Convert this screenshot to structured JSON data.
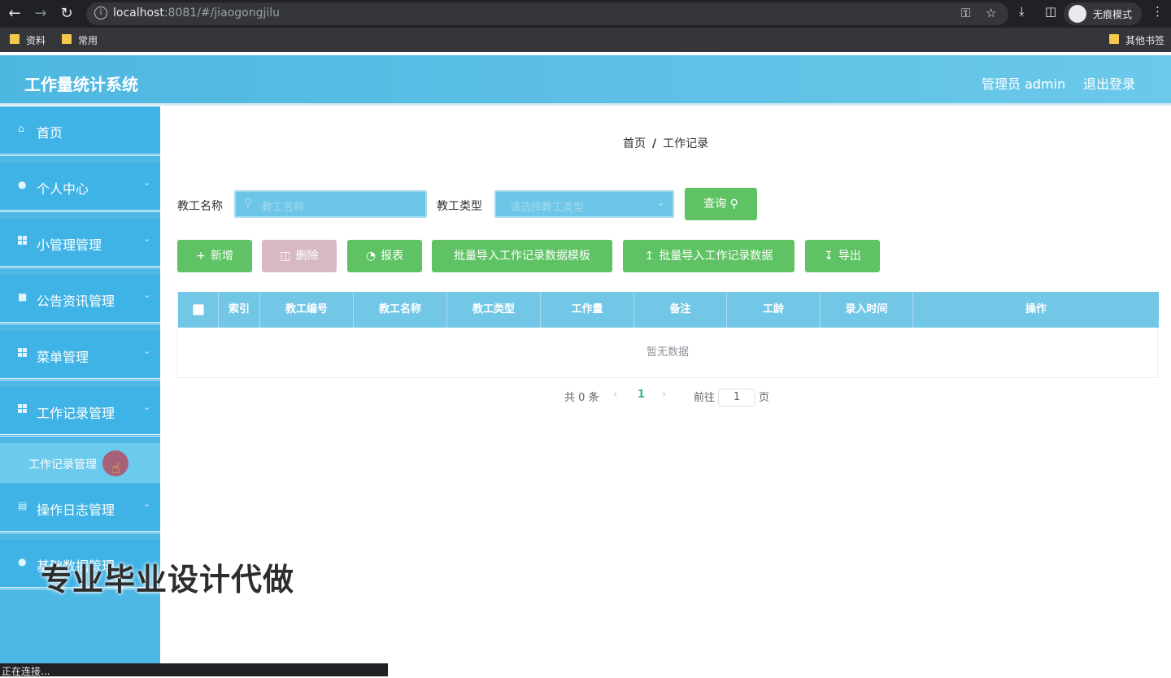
{
  "browser": {
    "url_host": "localhost",
    "url_rest": ":8081/#/jiaogongjilu",
    "incognito_label": "无痕模式",
    "bookmarks": [
      "资料",
      "常用"
    ],
    "other_bookmarks": "其他书签",
    "status_text": "正在连接..."
  },
  "header": {
    "title": "工作量统计系统",
    "admin_label": "管理员 admin",
    "logout_label": "退出登录"
  },
  "sidebar": {
    "items": [
      {
        "label": "首页",
        "icon": "home-icon"
      },
      {
        "label": "个人中心",
        "icon": "user-icon"
      },
      {
        "label": "小管理管理",
        "icon": "grid-icon"
      },
      {
        "label": "公告资讯管理",
        "icon": "message-icon"
      },
      {
        "label": "菜单管理",
        "icon": "grid-icon"
      },
      {
        "label": "工作记录管理",
        "icon": "grid-icon"
      },
      {
        "label": "操作日志管理",
        "icon": "briefcase-icon"
      },
      {
        "label": "基础数据管理",
        "icon": "user-icon"
      }
    ],
    "sub_item": "工作记录管理"
  },
  "watermark": "专业毕业设计代做",
  "breadcrumb": {
    "home": "首页",
    "sep": "/",
    "current": "工作记录"
  },
  "filters": {
    "name_label": "教工名称",
    "name_placeholder": "教工名称",
    "type_label": "教工类型",
    "type_placeholder": "请选择教工类型",
    "query_button": "查询"
  },
  "actions": {
    "add": "新增",
    "delete": "删除",
    "report": "报表",
    "import_template": "批量导入工作记录数据模板",
    "import_data": "批量导入工作记录数据",
    "export": "导出"
  },
  "table": {
    "headers": [
      "索引",
      "教工编号",
      "教工名称",
      "教工类型",
      "工作量",
      "备注",
      "工龄",
      "录入时间",
      "操作"
    ],
    "empty_text": "暂无数据"
  },
  "pagination": {
    "total": "共 0 条",
    "current_page": "1",
    "goto_label": "前往",
    "goto_value": "1",
    "page_suffix": "页"
  },
  "colors": {
    "header_bg": "#4eb7e0",
    "sidebar_bg": "#3fb3e5",
    "button_green": "#5fc264",
    "button_disabled": "#d8b8c1",
    "table_header": "#73c7e6"
  }
}
